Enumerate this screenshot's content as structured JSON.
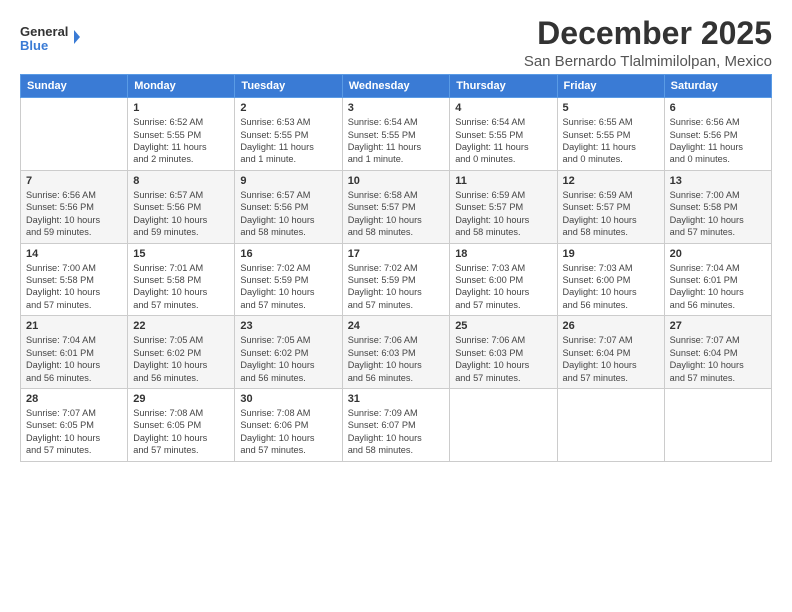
{
  "header": {
    "logo_line1": "General",
    "logo_line2": "Blue",
    "month": "December 2025",
    "location": "San Bernardo Tlalmimilolpan, Mexico"
  },
  "weekdays": [
    "Sunday",
    "Monday",
    "Tuesday",
    "Wednesday",
    "Thursday",
    "Friday",
    "Saturday"
  ],
  "weeks": [
    [
      {
        "day": "",
        "info": ""
      },
      {
        "day": "1",
        "info": "Sunrise: 6:52 AM\nSunset: 5:55 PM\nDaylight: 11 hours\nand 2 minutes."
      },
      {
        "day": "2",
        "info": "Sunrise: 6:53 AM\nSunset: 5:55 PM\nDaylight: 11 hours\nand 1 minute."
      },
      {
        "day": "3",
        "info": "Sunrise: 6:54 AM\nSunset: 5:55 PM\nDaylight: 11 hours\nand 1 minute."
      },
      {
        "day": "4",
        "info": "Sunrise: 6:54 AM\nSunset: 5:55 PM\nDaylight: 11 hours\nand 0 minutes."
      },
      {
        "day": "5",
        "info": "Sunrise: 6:55 AM\nSunset: 5:55 PM\nDaylight: 11 hours\nand 0 minutes."
      },
      {
        "day": "6",
        "info": "Sunrise: 6:56 AM\nSunset: 5:56 PM\nDaylight: 11 hours\nand 0 minutes."
      }
    ],
    [
      {
        "day": "7",
        "info": "Sunrise: 6:56 AM\nSunset: 5:56 PM\nDaylight: 10 hours\nand 59 minutes."
      },
      {
        "day": "8",
        "info": "Sunrise: 6:57 AM\nSunset: 5:56 PM\nDaylight: 10 hours\nand 59 minutes."
      },
      {
        "day": "9",
        "info": "Sunrise: 6:57 AM\nSunset: 5:56 PM\nDaylight: 10 hours\nand 58 minutes."
      },
      {
        "day": "10",
        "info": "Sunrise: 6:58 AM\nSunset: 5:57 PM\nDaylight: 10 hours\nand 58 minutes."
      },
      {
        "day": "11",
        "info": "Sunrise: 6:59 AM\nSunset: 5:57 PM\nDaylight: 10 hours\nand 58 minutes."
      },
      {
        "day": "12",
        "info": "Sunrise: 6:59 AM\nSunset: 5:57 PM\nDaylight: 10 hours\nand 58 minutes."
      },
      {
        "day": "13",
        "info": "Sunrise: 7:00 AM\nSunset: 5:58 PM\nDaylight: 10 hours\nand 57 minutes."
      }
    ],
    [
      {
        "day": "14",
        "info": "Sunrise: 7:00 AM\nSunset: 5:58 PM\nDaylight: 10 hours\nand 57 minutes."
      },
      {
        "day": "15",
        "info": "Sunrise: 7:01 AM\nSunset: 5:58 PM\nDaylight: 10 hours\nand 57 minutes."
      },
      {
        "day": "16",
        "info": "Sunrise: 7:02 AM\nSunset: 5:59 PM\nDaylight: 10 hours\nand 57 minutes."
      },
      {
        "day": "17",
        "info": "Sunrise: 7:02 AM\nSunset: 5:59 PM\nDaylight: 10 hours\nand 57 minutes."
      },
      {
        "day": "18",
        "info": "Sunrise: 7:03 AM\nSunset: 6:00 PM\nDaylight: 10 hours\nand 57 minutes."
      },
      {
        "day": "19",
        "info": "Sunrise: 7:03 AM\nSunset: 6:00 PM\nDaylight: 10 hours\nand 56 minutes."
      },
      {
        "day": "20",
        "info": "Sunrise: 7:04 AM\nSunset: 6:01 PM\nDaylight: 10 hours\nand 56 minutes."
      }
    ],
    [
      {
        "day": "21",
        "info": "Sunrise: 7:04 AM\nSunset: 6:01 PM\nDaylight: 10 hours\nand 56 minutes."
      },
      {
        "day": "22",
        "info": "Sunrise: 7:05 AM\nSunset: 6:02 PM\nDaylight: 10 hours\nand 56 minutes."
      },
      {
        "day": "23",
        "info": "Sunrise: 7:05 AM\nSunset: 6:02 PM\nDaylight: 10 hours\nand 56 minutes."
      },
      {
        "day": "24",
        "info": "Sunrise: 7:06 AM\nSunset: 6:03 PM\nDaylight: 10 hours\nand 56 minutes."
      },
      {
        "day": "25",
        "info": "Sunrise: 7:06 AM\nSunset: 6:03 PM\nDaylight: 10 hours\nand 57 minutes."
      },
      {
        "day": "26",
        "info": "Sunrise: 7:07 AM\nSunset: 6:04 PM\nDaylight: 10 hours\nand 57 minutes."
      },
      {
        "day": "27",
        "info": "Sunrise: 7:07 AM\nSunset: 6:04 PM\nDaylight: 10 hours\nand 57 minutes."
      }
    ],
    [
      {
        "day": "28",
        "info": "Sunrise: 7:07 AM\nSunset: 6:05 PM\nDaylight: 10 hours\nand 57 minutes."
      },
      {
        "day": "29",
        "info": "Sunrise: 7:08 AM\nSunset: 6:05 PM\nDaylight: 10 hours\nand 57 minutes."
      },
      {
        "day": "30",
        "info": "Sunrise: 7:08 AM\nSunset: 6:06 PM\nDaylight: 10 hours\nand 57 minutes."
      },
      {
        "day": "31",
        "info": "Sunrise: 7:09 AM\nSunset: 6:07 PM\nDaylight: 10 hours\nand 58 minutes."
      },
      {
        "day": "",
        "info": ""
      },
      {
        "day": "",
        "info": ""
      },
      {
        "day": "",
        "info": ""
      }
    ]
  ]
}
